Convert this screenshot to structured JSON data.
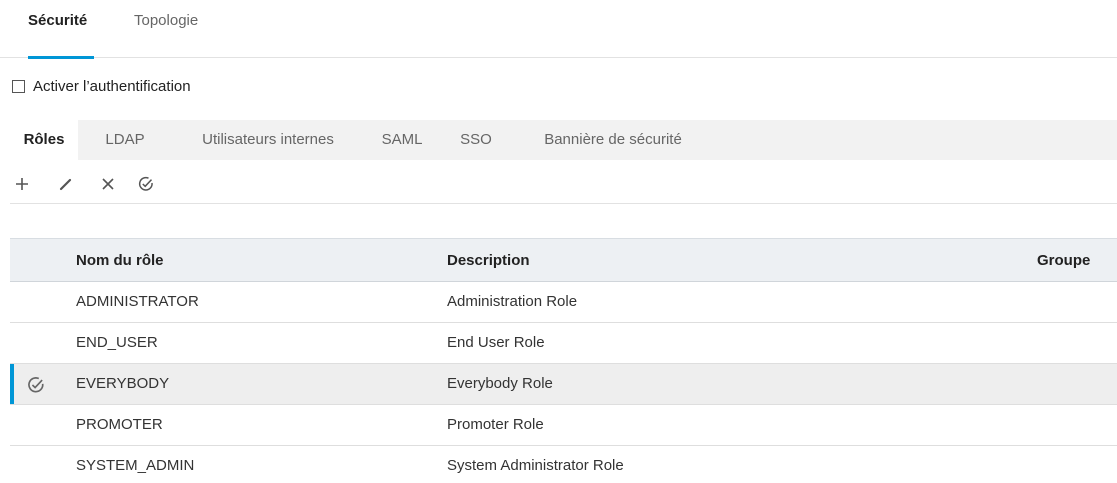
{
  "top_tabs": [
    {
      "label": "Sécurité",
      "active": true
    },
    {
      "label": "Topologie",
      "active": false
    }
  ],
  "auth": {
    "label": "Activer l’authentification",
    "checked": false
  },
  "sub_tabs": [
    {
      "label": "Rôles",
      "active": true
    },
    {
      "label": "LDAP",
      "active": false
    },
    {
      "label": "Utilisateurs internes",
      "active": false
    },
    {
      "label": "SAML",
      "active": false
    },
    {
      "label": "SSO",
      "active": false
    },
    {
      "label": "Bannière de sécurité",
      "active": false
    }
  ],
  "toolbar": {
    "icons": [
      "plus-icon",
      "pencil-icon",
      "close-icon",
      "check-circle-icon"
    ],
    "icon_color": "#555555"
  },
  "table": {
    "columns": [
      "Nom du rôle",
      "Description",
      "Groupe"
    ],
    "rows": [
      {
        "name": "ADMINISTRATOR",
        "description": "Administration Role",
        "group": "",
        "selected": false
      },
      {
        "name": "END_USER",
        "description": "End User Role",
        "group": "",
        "selected": false
      },
      {
        "name": "EVERYBODY",
        "description": "Everybody Role",
        "group": "",
        "selected": true
      },
      {
        "name": "PROMOTER",
        "description": "Promoter Role",
        "group": "",
        "selected": false
      },
      {
        "name": "SYSTEM_ADMIN",
        "description": "System Administrator Role",
        "group": "",
        "selected": false
      }
    ]
  },
  "colors": {
    "accent": "#0096d6",
    "selected_row": "#eeeeee",
    "header_bg": "#edf0f3"
  }
}
